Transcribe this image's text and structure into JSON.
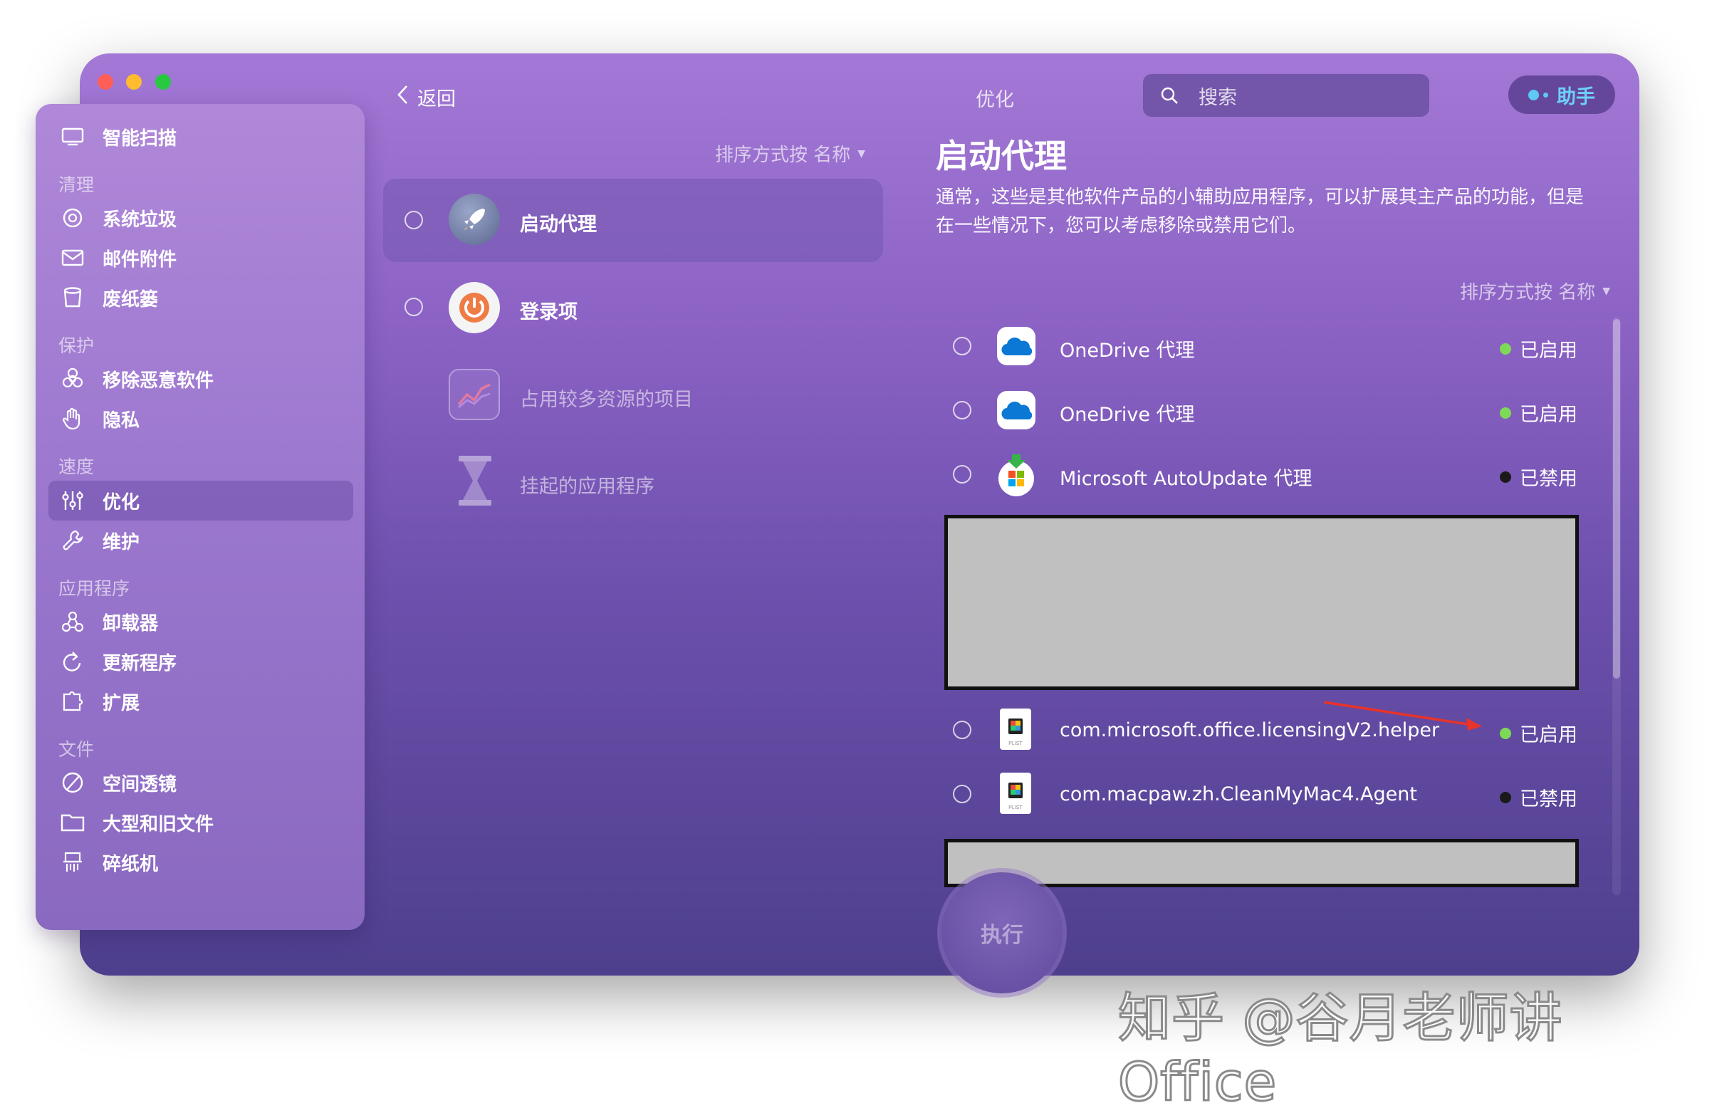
{
  "sidebar": {
    "smart_scan": "智能扫描",
    "sections": {
      "clean": "清理",
      "protect": "保护",
      "speed": "速度",
      "apps": "应用程序",
      "files": "文件"
    },
    "items": {
      "system_junk": "系统垃圾",
      "mail_attachments": "邮件附件",
      "trash_bins": "废纸篓",
      "malware_removal": "移除恶意软件",
      "privacy": "隐私",
      "optimization": "优化",
      "maintenance": "维护",
      "uninstaller": "卸载器",
      "updater": "更新程序",
      "extensions": "扩展",
      "space_lens": "空间透镜",
      "large_old_files": "大型和旧文件",
      "shredder": "碎纸机"
    }
  },
  "toolbar": {
    "back": "返回",
    "title": "优化",
    "search_placeholder": "搜索",
    "assistant": "助手"
  },
  "middle": {
    "sort_label": "排序方式按 名称",
    "categories": [
      {
        "label": "启动代理",
        "selected": true
      },
      {
        "label": "登录项",
        "selected": false
      },
      {
        "label": "占用较多资源的项目",
        "selected": false
      },
      {
        "label": "挂起的应用程序",
        "selected": false
      }
    ]
  },
  "detail": {
    "title": "启动代理",
    "description_line1": "通常，这些是其他软件产品的小辅助应用程序，可以扩展其主产品的功能，但是",
    "description_line2": "在一些情况下，您可以考虑移除或禁用它们。",
    "sort_label": "排序方式按 名称",
    "rows": [
      {
        "name": "OneDrive 代理",
        "status": "已启用",
        "icon": "onedrive-icon"
      },
      {
        "name": "OneDrive 代理",
        "status": "已启用",
        "icon": "onedrive-icon"
      },
      {
        "name": "Microsoft AutoUpdate 代理",
        "status": "已禁用",
        "icon": "microsoft-autoupdate-icon"
      },
      {
        "name": "com.microsoft.office.licensingV2.helper",
        "status": "已启用",
        "icon": "plist-file-icon"
      },
      {
        "name": "com.macpaw.zh.CleanMyMac4.Agent",
        "status": "已禁用",
        "icon": "plist-file-icon"
      }
    ],
    "file_badge": "PLIST"
  },
  "action_button": "执行",
  "watermark": "知乎 @谷月老师讲Office",
  "colors": {
    "enabled_dot": "#7ed957",
    "disabled_dot": "#1a1a1a",
    "annotation_arrow": "#e8332a"
  }
}
